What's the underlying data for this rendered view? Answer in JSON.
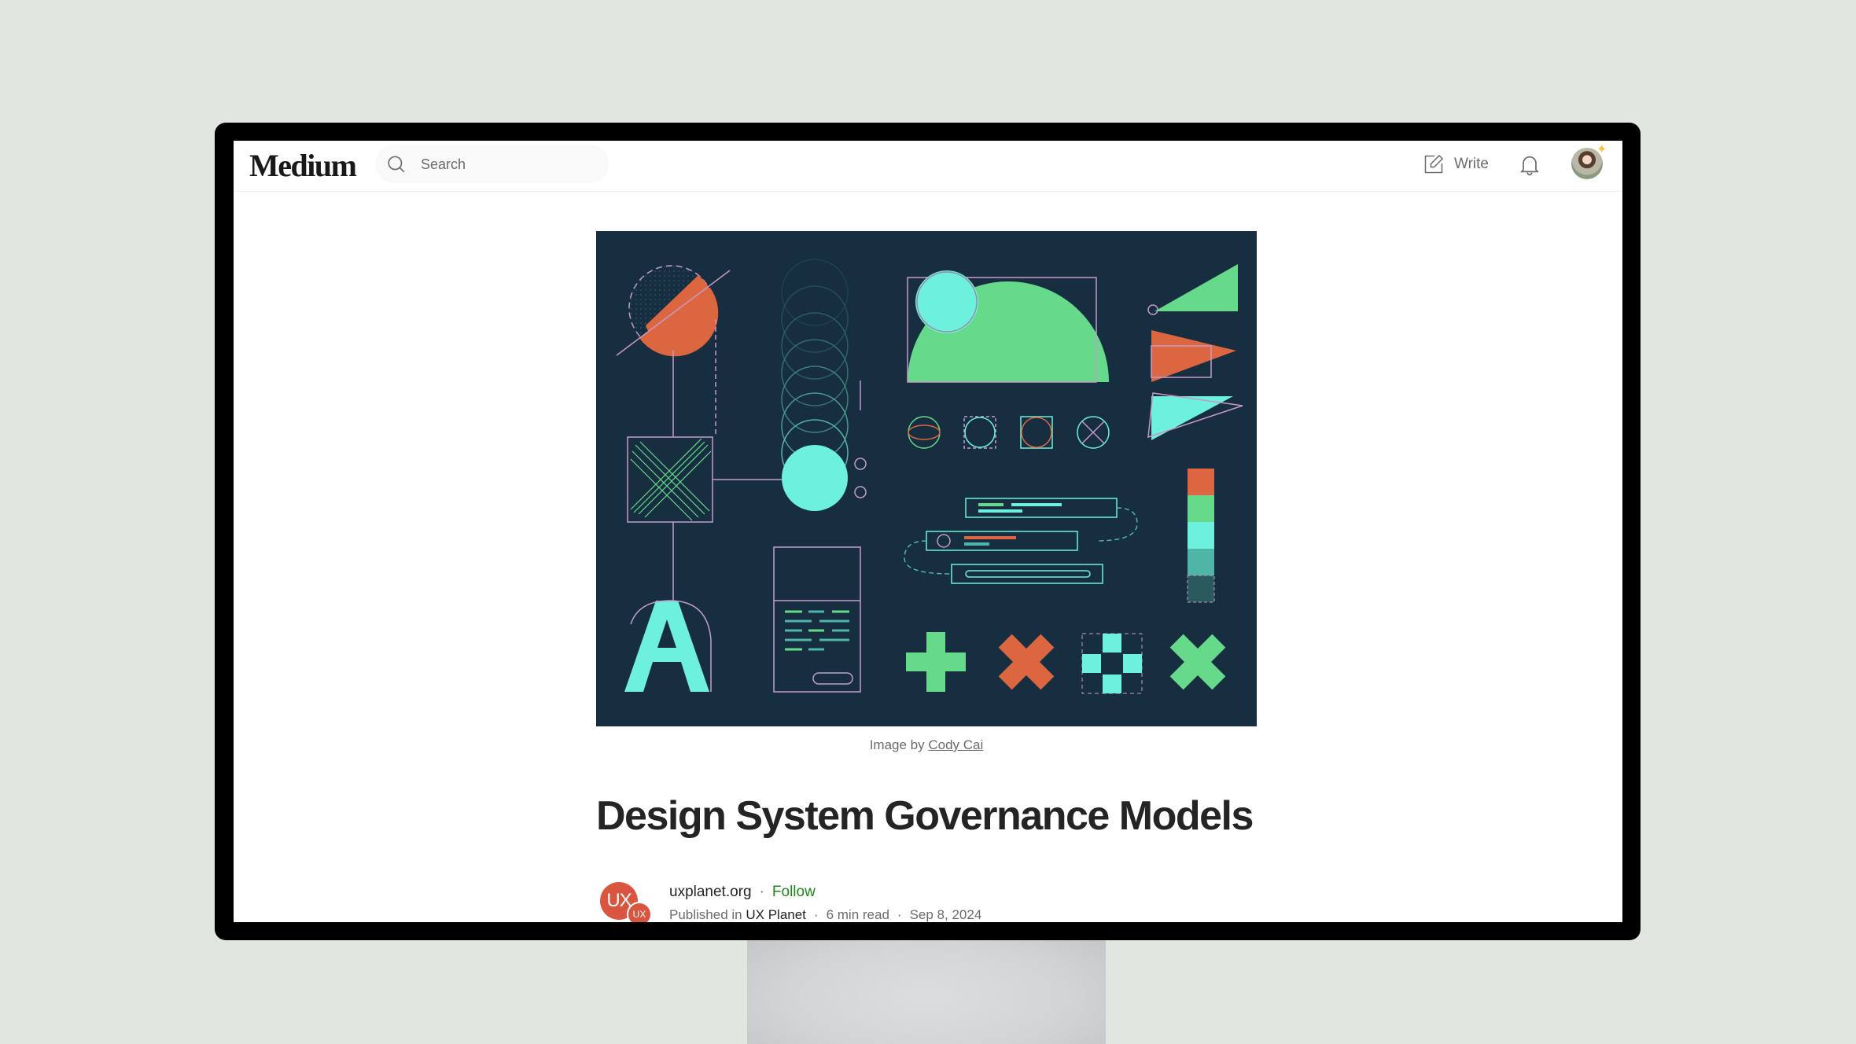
{
  "header": {
    "logo": "Medium",
    "search_placeholder": "Search",
    "write_label": "Write",
    "icons": [
      "search-icon",
      "write-icon",
      "bell-icon",
      "avatar"
    ]
  },
  "hero": {
    "alt": "Abstract design system illustration with geometric shapes",
    "caption_prefix": "Image by",
    "caption_link": "Cody Cai",
    "colors": {
      "background": "#172e40",
      "green": "#66d98a",
      "cyan": "#6df0dc",
      "orange": "#dc6640",
      "lilac": "#c59ac8",
      "teal": "#4fb5a6"
    }
  },
  "article": {
    "title": "Design System Governance Models",
    "author_avatar_text": "UX",
    "publication_badge_text": "UX",
    "author": "uxplanet.org",
    "separator": "·",
    "follow_label": "Follow",
    "published_in_label": "Published in",
    "publication": "UX Planet",
    "read_time": "6 min read",
    "date": "Sep 8, 2024"
  }
}
